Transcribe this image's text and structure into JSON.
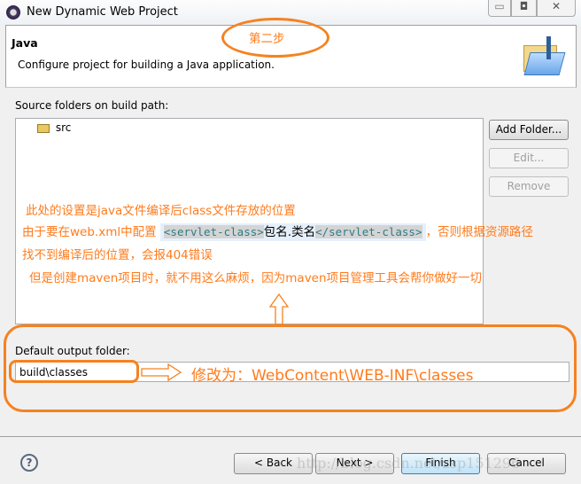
{
  "window": {
    "title": "New Dynamic Web Project"
  },
  "header": {
    "title": "Java",
    "description": "Configure project for building a Java application."
  },
  "source": {
    "label": "Source folders on build path:",
    "items": [
      "src"
    ]
  },
  "buttons": {
    "add_folder": "Add Folder...",
    "edit": "Edit...",
    "remove": "Remove",
    "back": "< Back",
    "next": "Next >",
    "finish": "Finish",
    "cancel": "Cancel"
  },
  "output": {
    "label": "Default output folder:",
    "value": "build\\classes"
  },
  "annotations": {
    "step": "第二步",
    "line1": "此处的设置是java文件编译后class文件存放的位置",
    "line2_prefix": "由于要在web.xml中配置 ",
    "code_open": "<servlet-class>",
    "code_mid": "包名.类名",
    "code_close": "</servlet-class>",
    "line2_suffix": "，否则根据资源路径",
    "line3": "找不到编译后的位置，会报404错误",
    "line4": "但是创建maven项目时，就不用这么麻烦，因为maven项目管理工具会帮你做好一切",
    "change_to": "修改为：WebContent\\WEB-INF\\classes"
  },
  "watermark": "http://blog.csdn.net/zsp151296",
  "colors": {
    "annotation": "#ff7b1c",
    "ellipse": "#f58220"
  }
}
